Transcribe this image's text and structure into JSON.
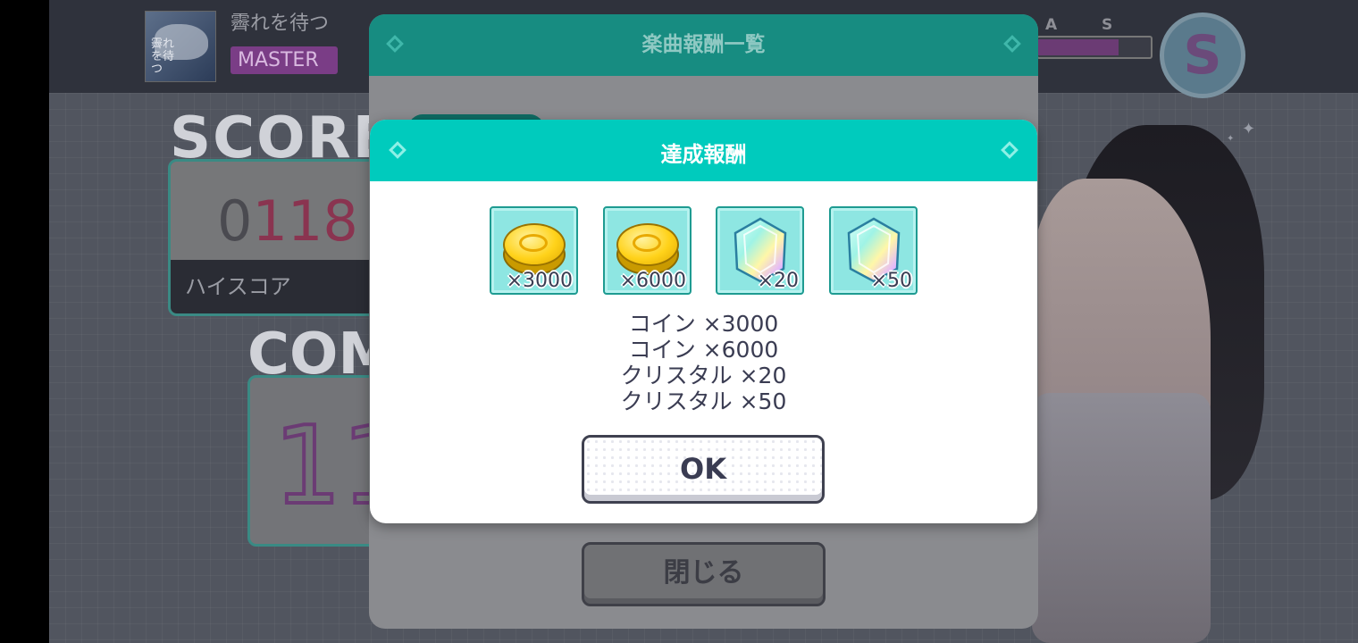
{
  "background": {
    "song_title": "霽れを待つ",
    "jacket_text": "霽れを待つ",
    "difficulty": "MASTER",
    "rank_labels": [
      "A",
      "S"
    ],
    "rank_emblem": "S",
    "score_label": "SCORE",
    "score_value_prefix": "0",
    "score_value_visible": "118",
    "highscore_label": "ハイスコア",
    "combo_label": "COM",
    "combo_value_visible": "11"
  },
  "back_dialog": {
    "title": "楽曲報酬一覧",
    "close_label": "閉じる"
  },
  "front_dialog": {
    "title": "達成報酬",
    "rewards": [
      {
        "icon": "coin-icon",
        "qty": "×3000"
      },
      {
        "icon": "coin-icon",
        "qty": "×6000"
      },
      {
        "icon": "crystal-icon",
        "qty": "×20"
      },
      {
        "icon": "crystal-icon",
        "qty": "×50"
      }
    ],
    "reward_lines": [
      "コイン ×3000",
      "コイン ×6000",
      "クリスタル ×20",
      "クリスタル ×50"
    ],
    "ok_label": "OK"
  },
  "colors": {
    "accent_teal": "#00cbbd",
    "dark_teal": "#178c81",
    "text_dark": "#3a3c52"
  }
}
